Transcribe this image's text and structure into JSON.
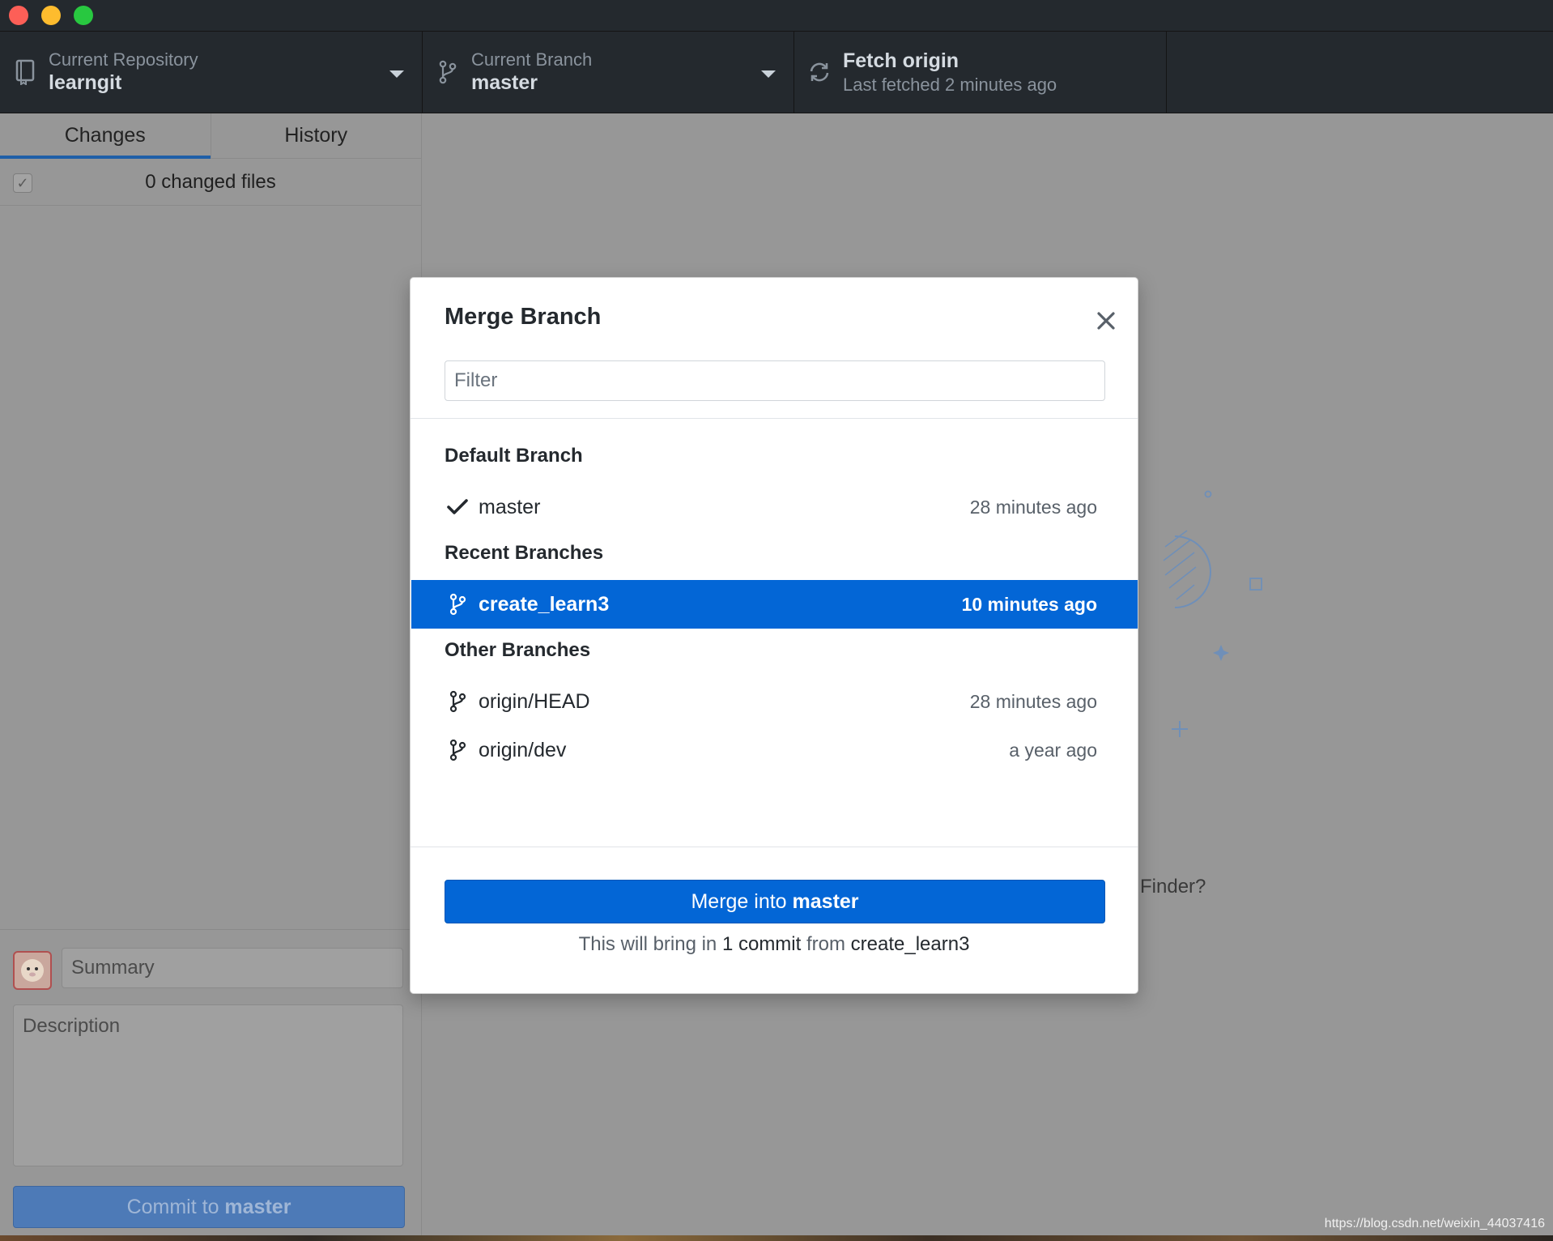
{
  "toolbar": {
    "repository": {
      "title": "Current Repository",
      "value": "learngit"
    },
    "branch": {
      "title": "Current Branch",
      "value": "master"
    },
    "fetch": {
      "title": "Fetch origin",
      "subtitle": "Last fetched 2 minutes ago"
    }
  },
  "sidebar": {
    "tabs": [
      {
        "label": "Changes",
        "active": true
      },
      {
        "label": "History",
        "active": false
      }
    ],
    "changed_files": "0 changed files",
    "commit": {
      "summary_placeholder": "Summary",
      "description_placeholder": "Description",
      "button_prefix": "Commit to ",
      "button_branch": "master"
    }
  },
  "main": {
    "finder_hint": "Finder?"
  },
  "modal": {
    "title": "Merge Branch",
    "filter_placeholder": "Filter",
    "groups": [
      {
        "header": "Default Branch",
        "branches": [
          {
            "name": "master",
            "time": "28 minutes ago",
            "icon": "check-icon",
            "selected": false
          }
        ]
      },
      {
        "header": "Recent Branches",
        "branches": [
          {
            "name": "create_learn3",
            "time": "10 minutes ago",
            "icon": "branch-icon",
            "selected": true
          }
        ]
      },
      {
        "header": "Other Branches",
        "branches": [
          {
            "name": "origin/HEAD",
            "time": "28 minutes ago",
            "icon": "branch-icon",
            "selected": false
          },
          {
            "name": "origin/dev",
            "time": "a year ago",
            "icon": "branch-icon",
            "selected": false
          }
        ]
      }
    ],
    "merge_button": {
      "prefix": "Merge into ",
      "target": "master"
    },
    "merge_info": {
      "part1": "This will bring in ",
      "count": "1 commit",
      "part2": " from ",
      "source": "create_learn3"
    }
  },
  "watermark": "https://blog.csdn.net/weixin_44037416",
  "colors": {
    "accent": "#0366d6",
    "toolbar_bg": "#24292e",
    "overlay_bg": "#979797"
  }
}
